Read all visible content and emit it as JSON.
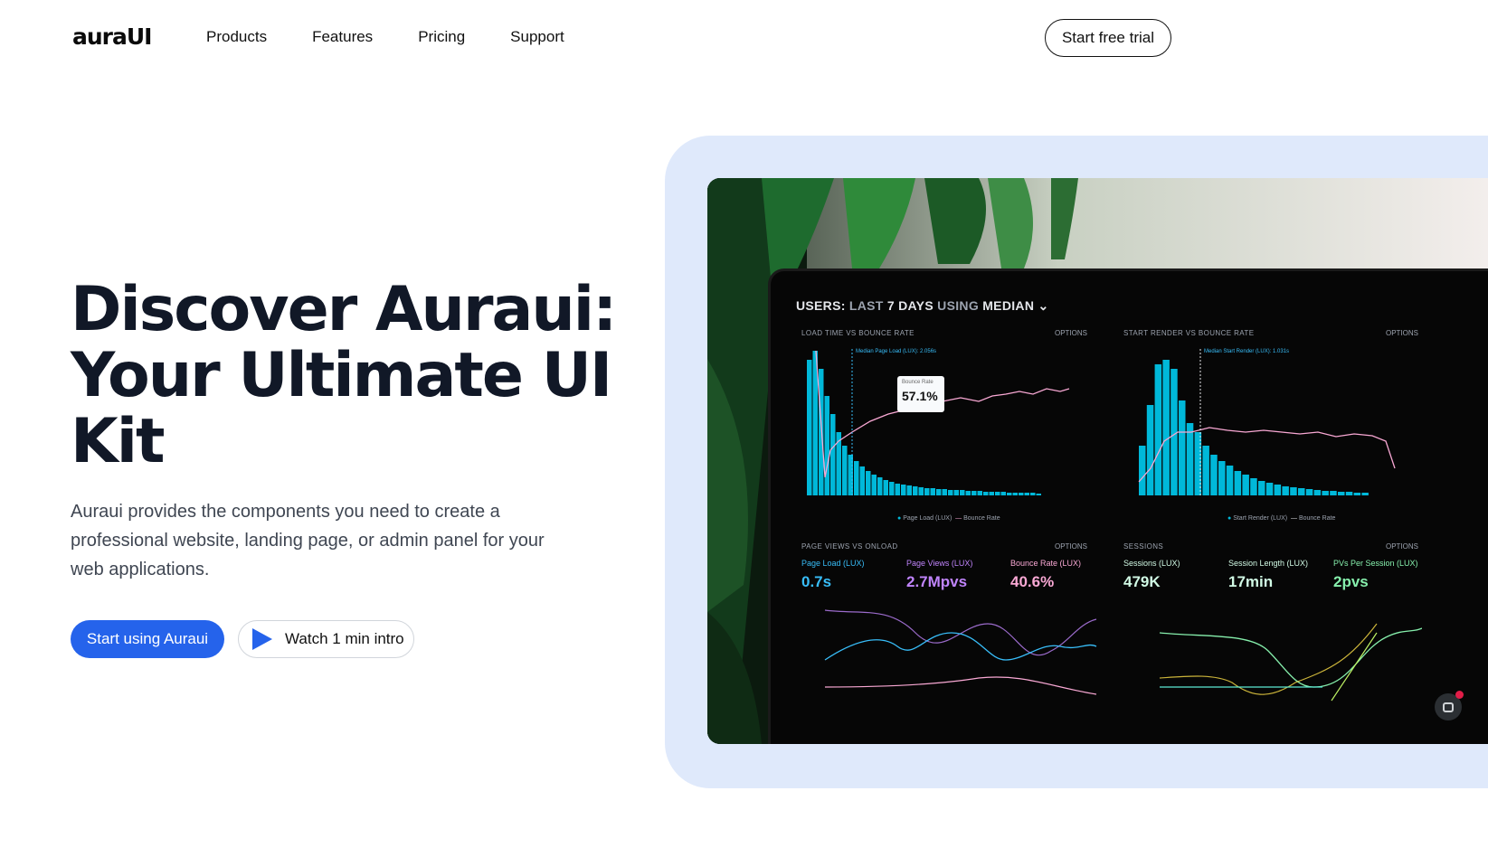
{
  "nav": {
    "logo": "auraUI",
    "links": [
      "Products",
      "Features",
      "Pricing",
      "Support"
    ],
    "cta": "Start free trial"
  },
  "hero": {
    "title_lines": [
      "Discover Auraui:",
      "Your Ultimate UI",
      "Kit"
    ],
    "description": "Auraui provides the components you need to create a professional website, landing page, or admin panel for your web applications.",
    "primary_button": "Start using Auraui",
    "secondary_button": "Watch 1 min intro"
  },
  "dashboard": {
    "header_prefix": "USERS:",
    "header_last": "LAST",
    "header_days": "7 DAYS",
    "header_using": "USING",
    "header_median": "MEDIAN",
    "panels": {
      "load_time": "LOAD TIME VS BOUNCE RATE",
      "start_render": "START RENDER VS BOUNCE RATE",
      "page_views": "PAGE VIEWS VS ONLOAD",
      "sessions": "SESSIONS"
    },
    "options_label": "OPTIONS",
    "tooltip_label": "Bounce Rate",
    "tooltip_value": "57.1%",
    "median_load": "Median Page Load (LUX): 2.056s",
    "median_render": "Median Start Render (LUX): 1.031s",
    "legend_left": [
      "Page Load (LUX)",
      "Bounce Rate"
    ],
    "legend_right": [
      "Start Render (LUX)",
      "Bounce Rate"
    ],
    "metrics": [
      {
        "label": "Page Load (LUX)",
        "value": "0.7s",
        "color": "#38bdf8"
      },
      {
        "label": "Page Views (LUX)",
        "value": "2.7Mpvs",
        "color": "#c084fc"
      },
      {
        "label": "Bounce Rate (LUX)",
        "value": "40.6%",
        "color": "#f9a8d4"
      },
      {
        "label": "Sessions (LUX)",
        "value": "479K",
        "color": "#d1fae5"
      },
      {
        "label": "Session Length (LUX)",
        "value": "17min",
        "color": "#d1fae5"
      },
      {
        "label": "PVs Per Session (LUX)",
        "value": "2pvs",
        "color": "#86efac"
      }
    ]
  },
  "colors": {
    "accent": "#2563eb",
    "frame": "#dfe9fb",
    "bars": "#00b8d9"
  }
}
